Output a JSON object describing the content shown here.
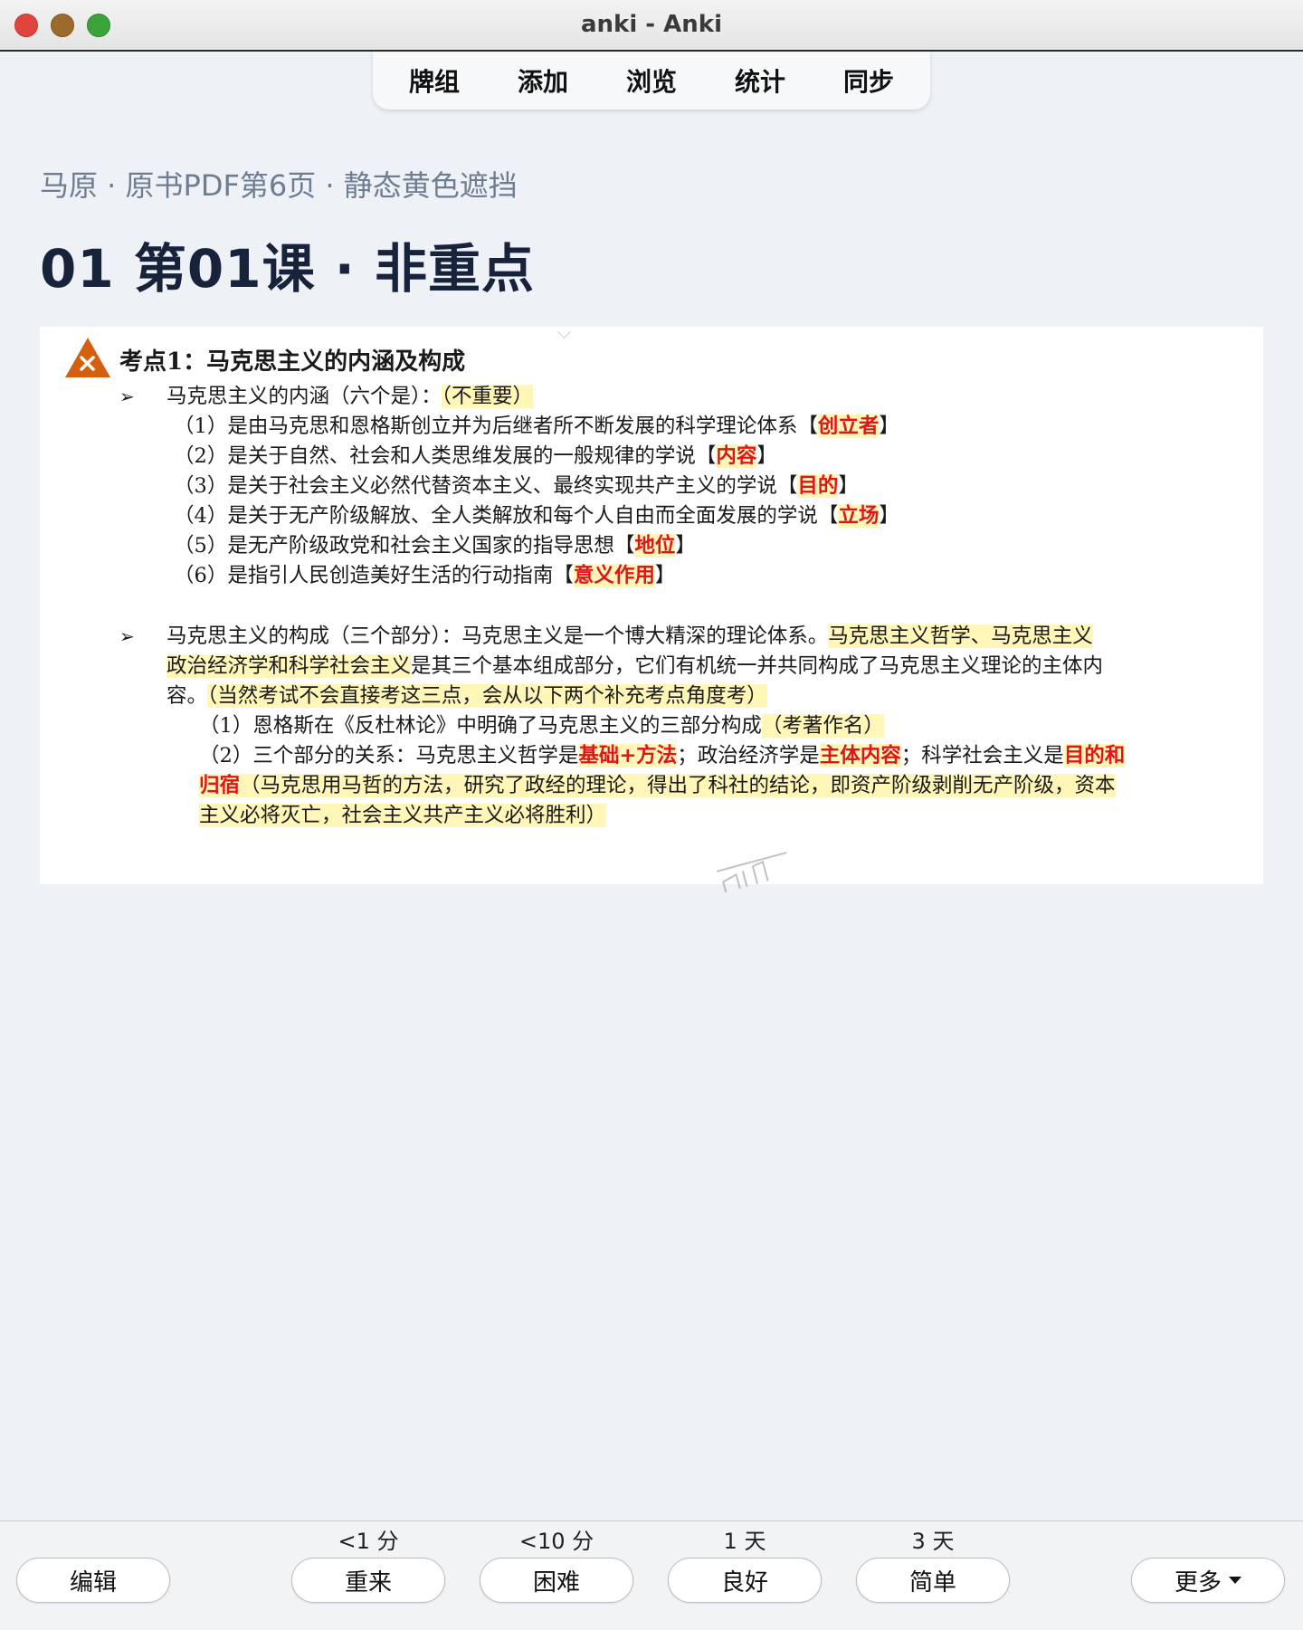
{
  "window": {
    "title": "anki - Anki"
  },
  "nav": {
    "items": [
      "牌组",
      "添加",
      "浏览",
      "统计",
      "同步"
    ]
  },
  "breadcrumb": "马原 · 原书PDF第6页 · 静态黄色遮挡",
  "page_title": "01 第01课 · 非重点",
  "card": {
    "heading": "考点1：马克思主义的内涵及构成",
    "bullet_symbol": "➢",
    "section1": {
      "intro": "马克思主义的内涵（六个是）：",
      "intro_note": "（不重要）",
      "items": [
        {
          "text": "（1）是由马克思和恩格斯创立并为后继者所不断发展的科学理论体系【",
          "key": "创立者",
          "close": "】"
        },
        {
          "text": "（2）是关于自然、社会和人类思维发展的一般规律的学说【",
          "key": "内容",
          "close": "】"
        },
        {
          "text": "（3）是关于社会主义必然代替资本主义、最终实现共产主义的学说【",
          "key": "目的",
          "close": "】"
        },
        {
          "text": "（4）是关于无产阶级解放、全人类解放和每个人自由而全面发展的学说【",
          "key": "立场",
          "close": "】"
        },
        {
          "text": "（5）是无产阶级政党和社会主义国家的指导思想【",
          "key": "地位",
          "close": "】"
        },
        {
          "text": "（6）是指引人民创造美好生活的行动指南【",
          "key": "意义作用",
          "close": "】"
        }
      ]
    },
    "section2": {
      "l1_a": "马克思主义的构成（三个部分）：马克思主义是一个博大精深的理论体系。",
      "l1_b": "马克思主义哲学、马克思主义",
      "l2_a": "政治经济学和科学社会主义",
      "l2_b": "是其三个基本组成部分，它们有机统一并共同构成了马克思主义理论的主体内",
      "l3_a": "容。",
      "l3_b": "（当然考试不会直接考这三点，会从以下两个补充考点角度考）",
      "l4_a": "（1）恩格斯在《反杜林论》中明确了马克思主义的三部分构成",
      "l4_b": "（考著作名）",
      "l5_a": "（2）三个部分的关系：马克思主义哲学是",
      "l5_b": "基础+方法",
      "l5_c": "；政治经济学是",
      "l5_d": "主体内容",
      "l5_e": "；科学社会主义是",
      "l5_f": "目的和",
      "l6_a": "归宿",
      "l6_b": "（马克思用马哲的方法，研究了政经的理论，得出了科社的结论，即资产阶级剥削无产阶级，资本",
      "l7": "主义必将灭亡，社会主义共产主义必将胜利）"
    }
  },
  "answer_buttons": {
    "edit": "编辑",
    "again": {
      "label": "重来",
      "interval": "<1 分"
    },
    "hard": {
      "label": "困难",
      "interval": "<10 分"
    },
    "good": {
      "label": "良好",
      "interval": "1 天"
    },
    "easy": {
      "label": "简单",
      "interval": "3 天"
    },
    "more": "更多"
  },
  "colors": {
    "highlight": "#fff6b8",
    "answer_red": "#e0151b",
    "warning_icon": "#d4600f"
  }
}
